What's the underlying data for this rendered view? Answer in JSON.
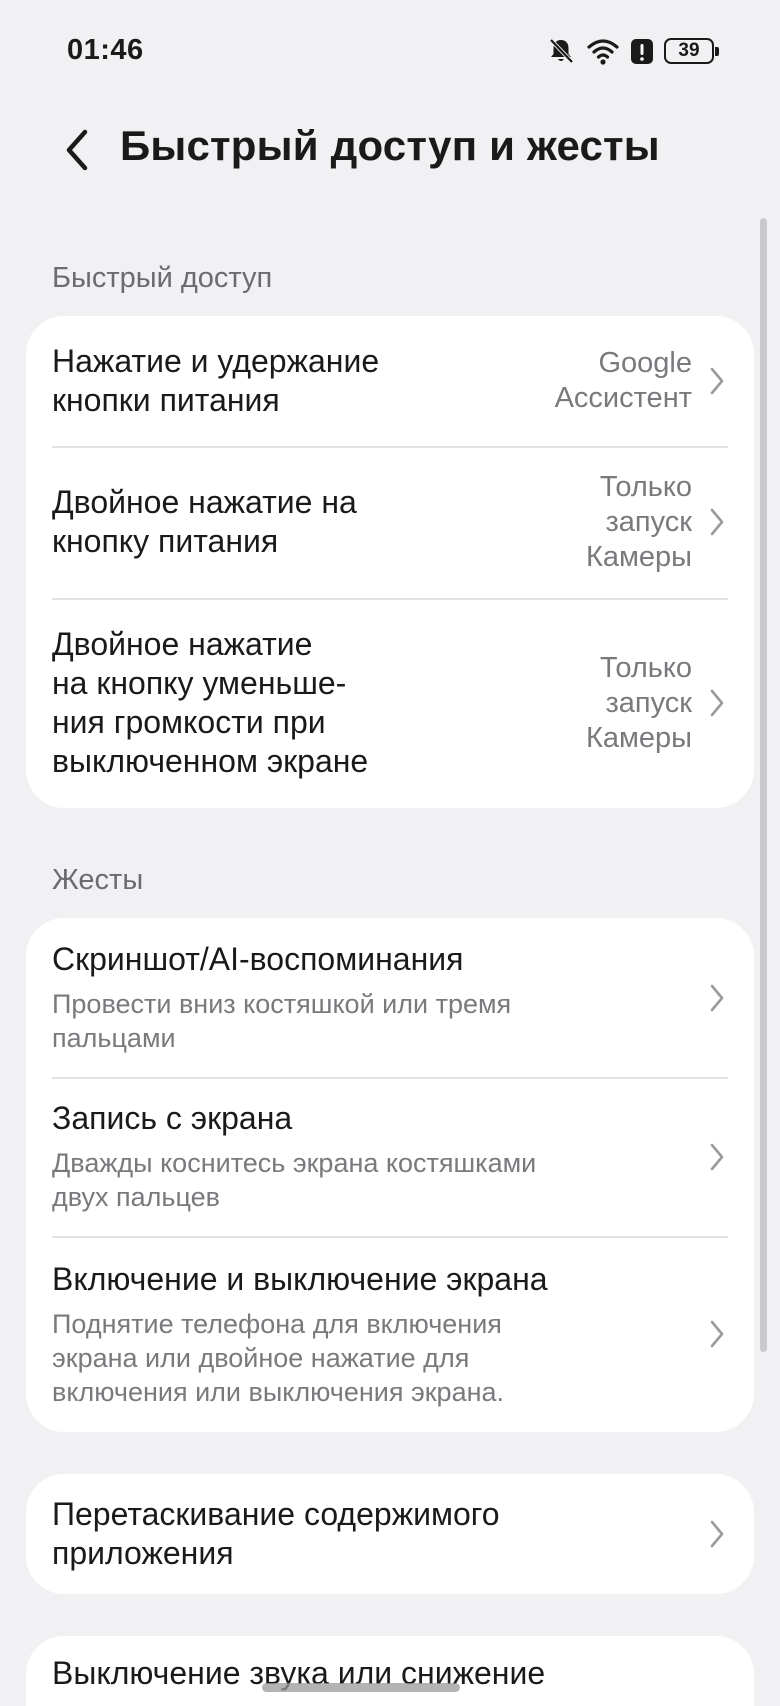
{
  "status_bar": {
    "time": "01:46",
    "battery": "39",
    "icons": [
      "bell-muted-icon",
      "wifi-icon",
      "alert-icon",
      "battery-icon"
    ]
  },
  "header": {
    "title": "Быстрый доступ и жесты",
    "back_icon": "chevron-left-icon"
  },
  "sections": {
    "quick_access": {
      "label": "Быстрый доступ",
      "items": [
        {
          "title": "Нажатие и удержание\nкнопки питания",
          "value": "Google\nАссистент"
        },
        {
          "title": "Двойное нажатие на\nкнопку питания",
          "value": "Только\nзапуск\nКамеры"
        },
        {
          "title": "Двойное нажатие\nна кнопку уменьше-\nния громкости при\nвыключенном экране",
          "value": "Только\nзапуск\nКамеры"
        }
      ]
    },
    "gestures": {
      "label": "Жесты",
      "items": [
        {
          "title": "Скриншот/AI-воспоминания",
          "subtitle": "Провести вниз костяшкой или тремя\nпальцами"
        },
        {
          "title": "Запись с экрана",
          "subtitle": "Дважды коснитесь экрана костяшками\nдвух пальцев"
        },
        {
          "title": "Включение и выключение экрана",
          "subtitle": "Поднятие телефона для включения\nэкрана или двойное нажатие для\nвключения или выключения экрана."
        }
      ]
    },
    "drag": {
      "items": [
        {
          "title": "Перетаскивание содержимого\nприложения"
        }
      ]
    },
    "mute": {
      "items": [
        {
          "title": "Выключение звука или снижение"
        }
      ]
    }
  },
  "colors": {
    "background": "#f1f1f3",
    "card": "#ffffff",
    "primary_text": "#1a1a1a",
    "secondary_text": "#7a7a7e",
    "chevron": "#9a9a9e"
  }
}
